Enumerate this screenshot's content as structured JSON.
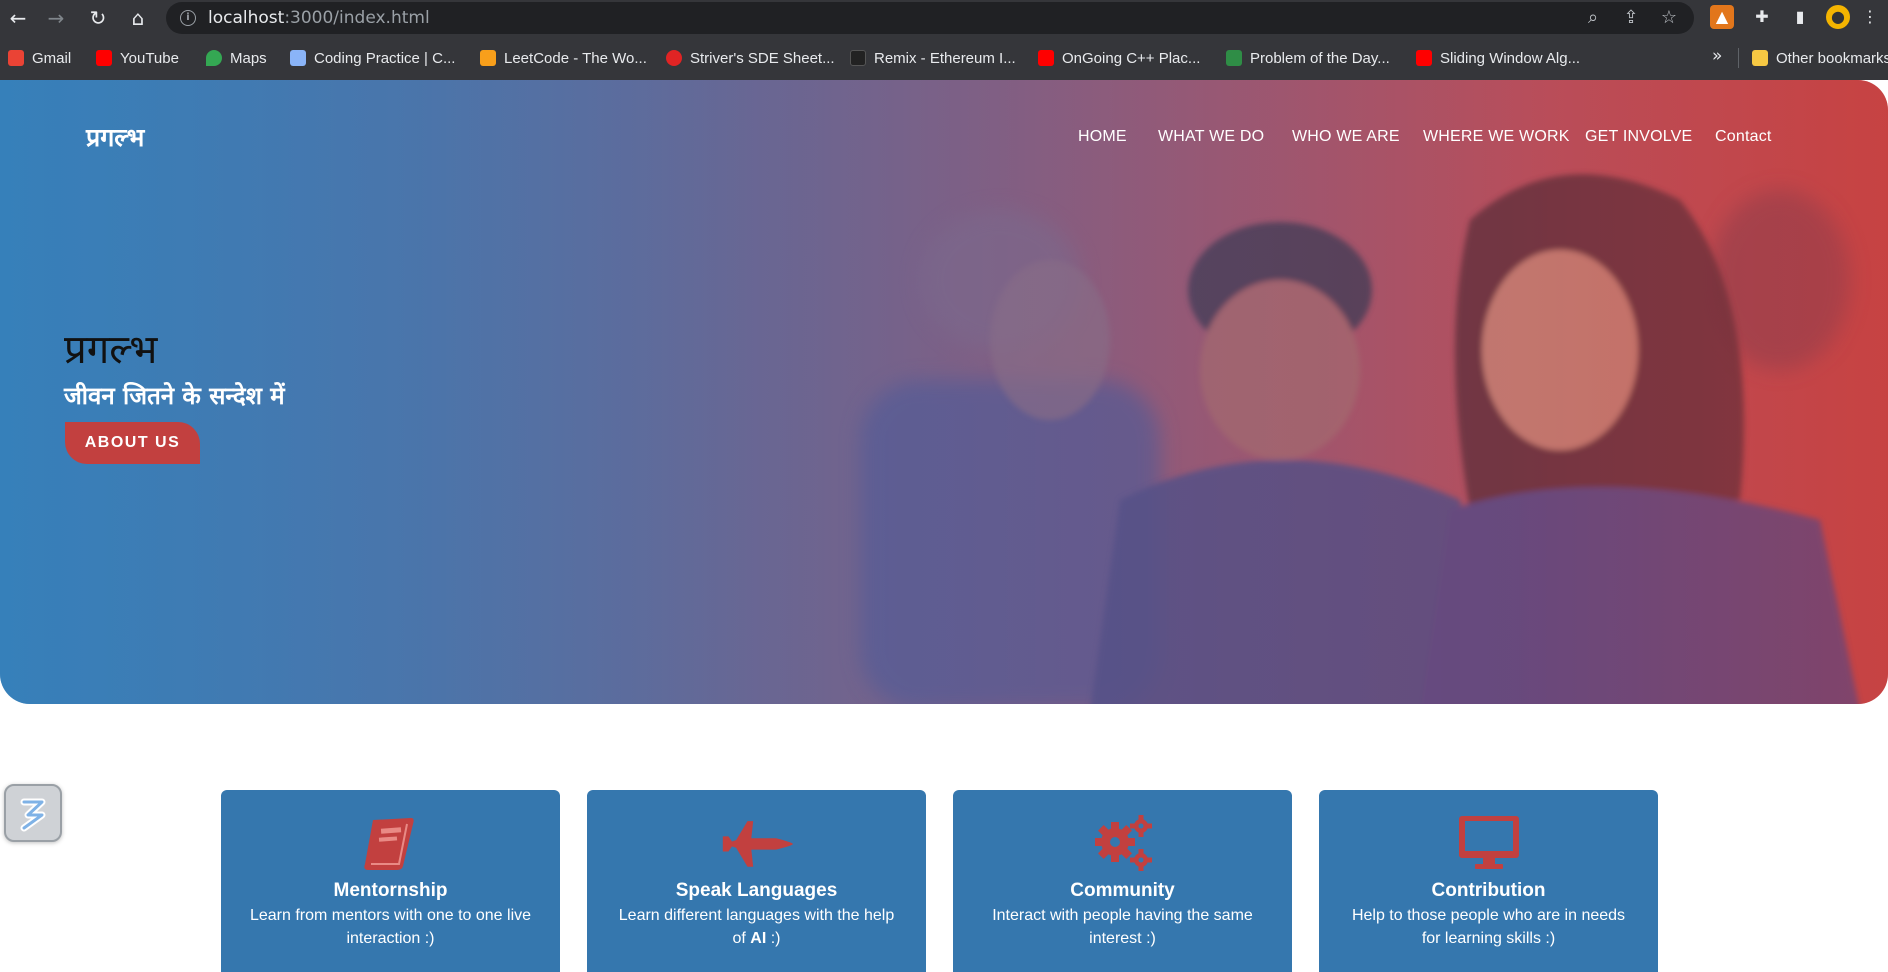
{
  "browser": {
    "url_host": "localhost",
    "url_path": ":3000/index.html",
    "bookmarks": [
      {
        "label": "Gmail",
        "icon": "gmail-icon",
        "color": "#ea4335"
      },
      {
        "label": "YouTube",
        "icon": "youtube-icon",
        "color": "#ff0000"
      },
      {
        "label": "Maps",
        "icon": "maps-icon",
        "color": "#34a853"
      },
      {
        "label": "Coding Practice | C...",
        "icon": "mountain-icon",
        "color": "#8ab4f8"
      },
      {
        "label": "LeetCode - The Wo...",
        "icon": "leetcode-icon",
        "color": "#f89f1b"
      },
      {
        "label": "Striver's SDE Sheet...",
        "icon": "tuf-icon",
        "color": "#e02424"
      },
      {
        "label": "Remix - Ethereum I...",
        "icon": "remix-icon",
        "color": "#222222"
      },
      {
        "label": "OnGoing C++ Plac...",
        "icon": "youtube-icon",
        "color": "#ff0000"
      },
      {
        "label": "Problem of the Day...",
        "icon": "gfg-icon",
        "color": "#2f8d46"
      },
      {
        "label": "Sliding Window Alg...",
        "icon": "youtube-icon",
        "color": "#ff0000"
      }
    ],
    "more_label": "»",
    "other_bookmarks": "Other bookmarks"
  },
  "site": {
    "logo": "प्रगल्भ",
    "menu": [
      "HOME",
      "WHAT WE DO",
      "WHO WE ARE",
      "WHERE WE WORK",
      "GET INVOLVE",
      "Contact"
    ],
    "hero_title": "प्रगल्भ",
    "hero_subtitle": "जीवन जितने के सन्देश में",
    "cta": "ABOUT US"
  },
  "cards": [
    {
      "title": "Mentornship",
      "icon": "book-icon",
      "desc_line1": "Learn from mentors with one to one live",
      "desc_line2": "interaction :)",
      "bold": ""
    },
    {
      "title": "Speak Languages",
      "icon": "jet-icon",
      "desc_line1": "Learn different languages with the help",
      "desc_line2": "of ",
      "bold": "AI",
      "desc_tail": " :)"
    },
    {
      "title": "Community",
      "icon": "gears-icon",
      "desc_line1": "Interact with people having the same",
      "desc_line2": "interest :)",
      "bold": ""
    },
    {
      "title": "Contribution",
      "icon": "monitor-icon",
      "desc_line1": "Help to those people who are in needs",
      "desc_line2": "for learning skills :)",
      "bold": ""
    }
  ],
  "colors": {
    "hero_blue": "#3680ba",
    "hero_red": "#c64646",
    "card_blue": "#3577ae",
    "accent_red": "#c2403f"
  }
}
